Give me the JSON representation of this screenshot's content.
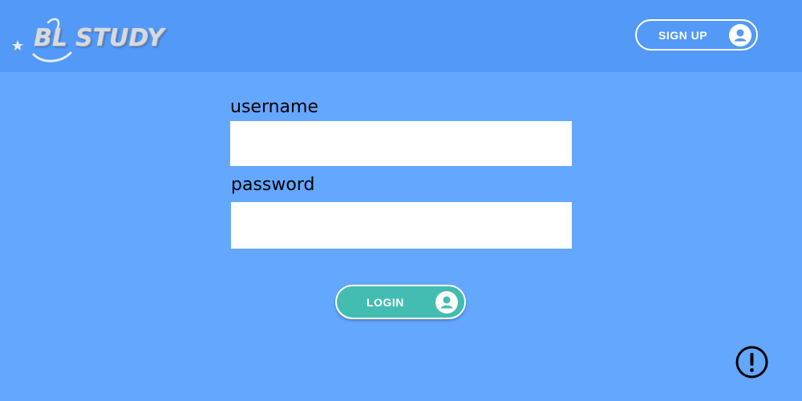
{
  "header": {
    "logo_text": "BL STUDY",
    "logo_initials": "BL",
    "logo_word": "STUDY",
    "signup_label": "SIGN UP"
  },
  "form": {
    "username_label": "username",
    "username_value": "",
    "password_label": "password",
    "password_value": "",
    "login_label": "LOGIN"
  },
  "icons": {
    "signup": "user-circle-icon",
    "login": "user-circle-icon",
    "help": "exclamation-circle-icon",
    "logo": "star-swoosh-icon"
  },
  "colors": {
    "header_bg": "#5399f7",
    "page_bg": "#64a7ff",
    "login_button": "#43bdb2",
    "white": "#ffffff"
  }
}
